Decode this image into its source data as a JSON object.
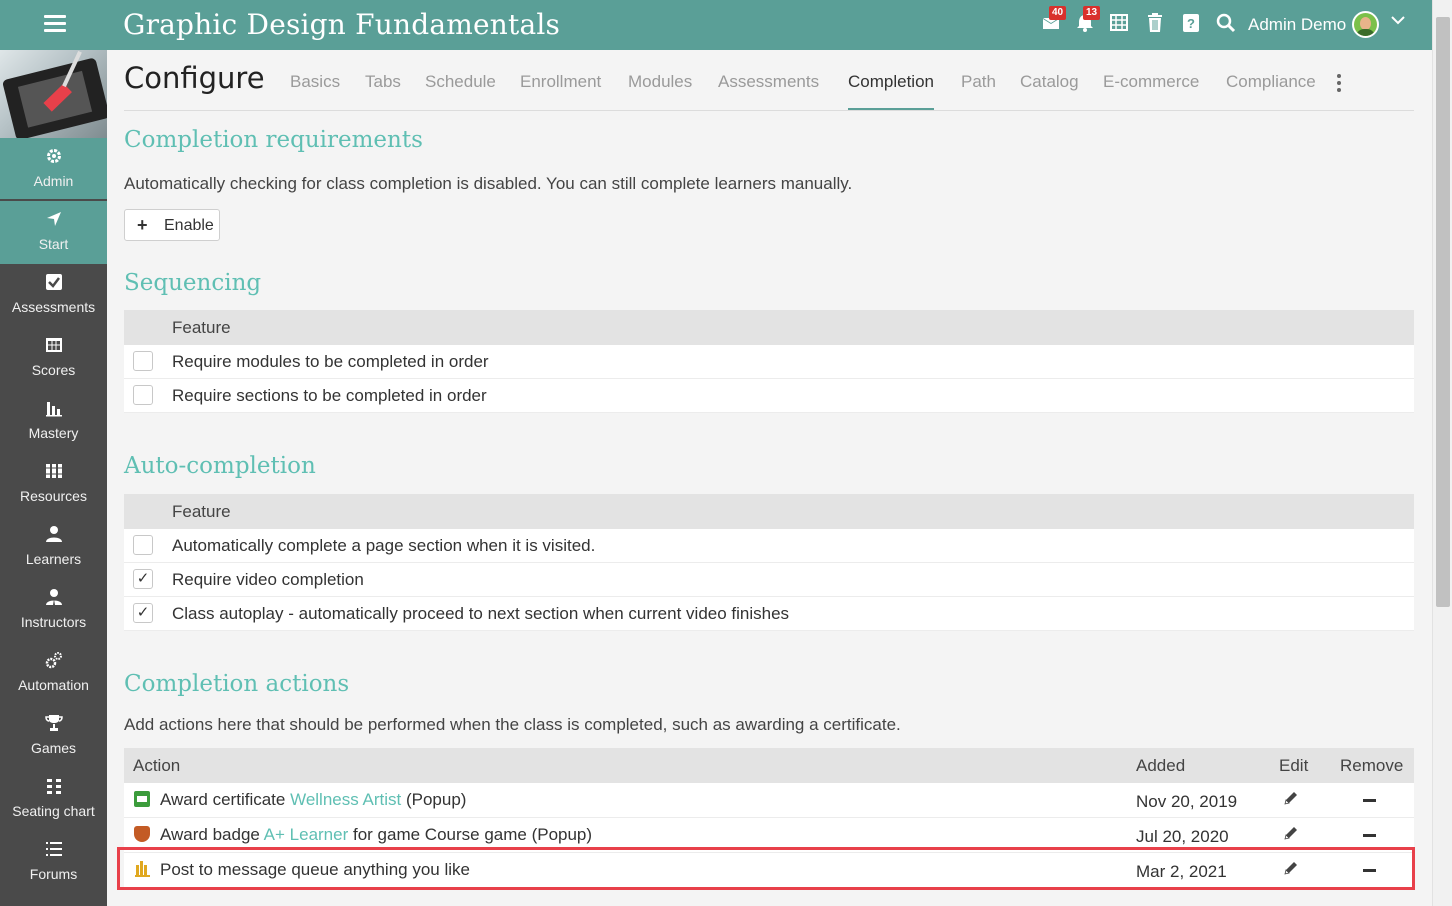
{
  "topbar": {
    "title": "Graphic Design Fundamentals",
    "messages_badge": "40",
    "notifications_badge": "13",
    "user_name": "Admin Demo"
  },
  "sidebar": {
    "items": [
      {
        "label": "Admin",
        "icon": "gear-icon"
      },
      {
        "label": "Start",
        "icon": "location-arrow-icon"
      },
      {
        "label": "Assessments",
        "icon": "checkbox-icon"
      },
      {
        "label": "Scores",
        "icon": "gradebook-icon"
      },
      {
        "label": "Mastery",
        "icon": "bar-chart-icon"
      },
      {
        "label": "Resources",
        "icon": "books-icon"
      },
      {
        "label": "Learners",
        "icon": "user-icon"
      },
      {
        "label": "Instructors",
        "icon": "instructor-icon"
      },
      {
        "label": "Automation",
        "icon": "gears-icon"
      },
      {
        "label": "Games",
        "icon": "trophy-icon"
      },
      {
        "label": "Seating chart",
        "icon": "grid-icon"
      },
      {
        "label": "Forums",
        "icon": "list-icon"
      }
    ]
  },
  "page": {
    "title": "Configure",
    "tabs": [
      "Basics",
      "Tabs",
      "Schedule",
      "Enrollment",
      "Modules",
      "Assessments",
      "Completion",
      "Path",
      "Catalog",
      "E-commerce",
      "Compliance"
    ],
    "active_tab": "Completion"
  },
  "completion_requirements": {
    "heading": "Completion requirements",
    "description": "Automatically checking for class completion is disabled. You can still complete learners manually.",
    "enable_label": "Enable"
  },
  "sequencing": {
    "heading": "Sequencing",
    "column": "Feature",
    "rows": [
      {
        "label": "Require modules to be completed in order",
        "checked": false
      },
      {
        "label": "Require sections to be completed in order",
        "checked": false
      }
    ]
  },
  "auto_completion": {
    "heading": "Auto-completion",
    "column": "Feature",
    "rows": [
      {
        "label": "Automatically complete a page section when it is visited.",
        "checked": false
      },
      {
        "label": "Require video completion",
        "checked": true
      },
      {
        "label": "Class autoplay - automatically proceed to next section when current video finishes",
        "checked": true
      }
    ]
  },
  "completion_actions": {
    "heading": "Completion actions",
    "description": "Add actions here that should be performed when the class is completed, such as awarding a certificate.",
    "columns": {
      "action": "Action",
      "added": "Added",
      "edit": "Edit",
      "remove": "Remove"
    },
    "rows": [
      {
        "prefix": "Award certificate ",
        "link": "Wellness Artist",
        "suffix": " (Popup)",
        "added": "Nov 20, 2019",
        "icon": "certificate-icon"
      },
      {
        "prefix": "Award badge ",
        "link": "A+ Learner",
        "suffix": " for game Course game (Popup)",
        "added": "Jul 20, 2020",
        "icon": "badge-icon"
      },
      {
        "prefix": "Post to message queue anything you like",
        "link": "",
        "suffix": "",
        "added": "Mar 2, 2021",
        "icon": "message-queue-icon"
      }
    ]
  }
}
